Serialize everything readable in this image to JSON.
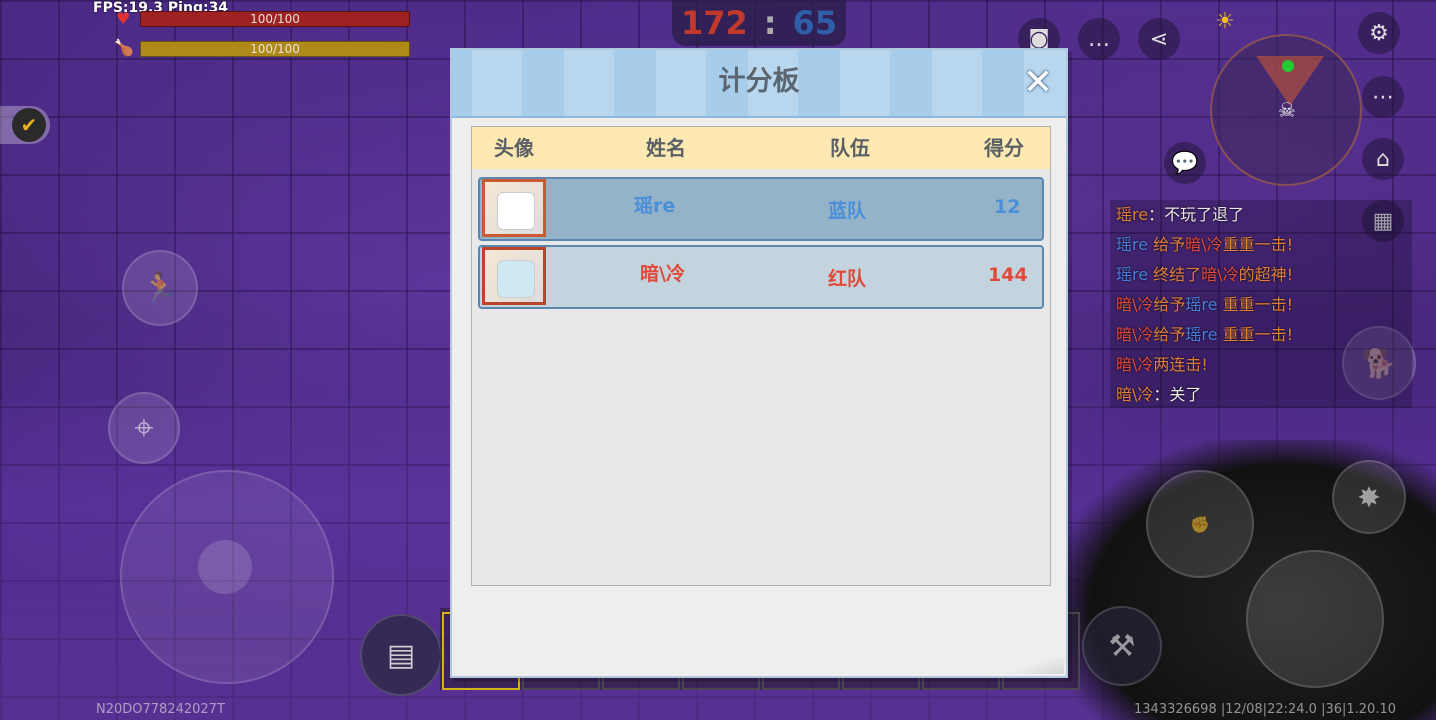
{
  "hud": {
    "fps_text": "FPS:19.3  Ping:34",
    "health_text": "100/100",
    "hunger_text": "100/100",
    "score_red": "172",
    "score_sep": ":",
    "score_blue": "65"
  },
  "scoreboard": {
    "title": "计分板",
    "close_label": "✕",
    "columns": {
      "avatar": "头像",
      "name": "姓名",
      "team": "队伍",
      "score": "得分"
    },
    "rows": [
      {
        "name": "瑶re",
        "team": "蓝队",
        "score": "12"
      },
      {
        "name": "暗\\冷",
        "team": "红队",
        "score": "144"
      }
    ]
  },
  "chat": [
    {
      "parts": [
        {
          "t": "瑶re",
          "c": "o"
        },
        {
          "t": "：不玩了退了",
          "c": ""
        }
      ]
    },
    {
      "parts": [
        {
          "t": "瑶re",
          "c": "b"
        },
        {
          "t": " 给予",
          "c": "o"
        },
        {
          "t": "暗\\冷",
          "c": "r"
        },
        {
          "t": "重重一击!",
          "c": "o"
        }
      ]
    },
    {
      "parts": [
        {
          "t": "瑶re",
          "c": "b"
        },
        {
          "t": " 终结了",
          "c": "o"
        },
        {
          "t": "暗\\冷",
          "c": "r"
        },
        {
          "t": "的超神!",
          "c": "o"
        }
      ]
    },
    {
      "parts": [
        {
          "t": "暗\\冷",
          "c": "r"
        },
        {
          "t": "给予",
          "c": "o"
        },
        {
          "t": "瑶re",
          "c": "b"
        },
        {
          "t": "  重重一击!",
          "c": "o"
        }
      ]
    },
    {
      "parts": [
        {
          "t": "暗\\冷",
          "c": "r"
        },
        {
          "t": "给予",
          "c": "o"
        },
        {
          "t": "瑶re",
          "c": "b"
        },
        {
          "t": "  重重一击!",
          "c": "o"
        }
      ]
    },
    {
      "parts": [
        {
          "t": "暗\\冷",
          "c": "r"
        },
        {
          "t": "两连击!",
          "c": "o"
        }
      ]
    },
    {
      "parts": [
        {
          "t": "暗\\冷",
          "c": "o"
        },
        {
          "t": "：关了",
          "c": ""
        }
      ]
    }
  ],
  "footer": {
    "left_id": "N20DO778242027T",
    "right_info": "1343326698   |12/08|22:24.0   |36|1.20.10"
  },
  "colors": {
    "red_team": "#e04a3a",
    "blue_team": "#4a8fd8",
    "header": "#a7cdeb",
    "table_head": "#fde9b1"
  },
  "icons": [
    "heart-icon",
    "drumstick-icon",
    "camera-icon",
    "chat-icon",
    "share-icon",
    "settings-icon",
    "sun-icon",
    "more-icon",
    "home-icon",
    "book-icon",
    "dog-icon",
    "run-icon",
    "crosshair-icon",
    "backpack-icon",
    "avatar-icon",
    "close-icon",
    "coin-icon"
  ]
}
